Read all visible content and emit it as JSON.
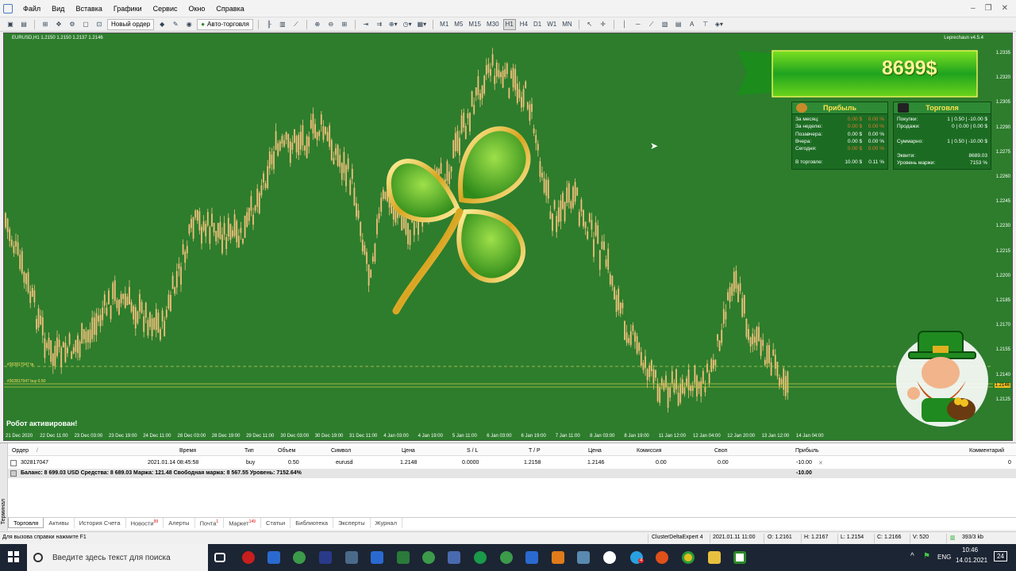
{
  "menu": {
    "items": [
      "Файл",
      "Вид",
      "Вставка",
      "Графики",
      "Сервис",
      "Окно",
      "Справка"
    ],
    "controls": [
      "–",
      "❐",
      "✕"
    ]
  },
  "toolbar": {
    "new_order": "Новый ордер",
    "auto_trading": "Авто-торговля",
    "timeframes": [
      "M1",
      "M5",
      "M15",
      "M30",
      "H1",
      "H4",
      "D1",
      "W1",
      "MN"
    ],
    "text_tool": "A"
  },
  "chart": {
    "title": "EURUSD,H1  1.2150 1.2150 1.2137 1.2146",
    "indicator_version": "Leprechaun v4.5.4",
    "robot_message": "Робот активирован!",
    "tp_label": "#302817047 tp",
    "buy_label": "#302817047 buy 0.50",
    "current_price": "1.2146",
    "price_ticks": [
      "1.2335",
      "1.2320",
      "1.2305",
      "1.2290",
      "1.2275",
      "1.2260",
      "1.2245",
      "1.2230",
      "1.2215",
      "1.2200",
      "1.2185",
      "1.2170",
      "1.2155",
      "1.2140",
      "1.2125"
    ],
    "time_ticks": [
      "21 Dec 2020",
      "22 Dec 11:00",
      "23 Dec 03:00",
      "23 Dec 19:00",
      "24 Dec 11:00",
      "28 Dec 03:00",
      "28 Dec 19:00",
      "29 Dec 11:00",
      "30 Dec 03:00",
      "30 Dec 19:00",
      "31 Dec 11:00",
      "4 Jan 03:00",
      "4 Jan 19:00",
      "5 Jan 11:00",
      "6 Jan 03:00",
      "6 Jan 19:00",
      "7 Jan 11:00",
      "8 Jan 03:00",
      "8 Jan 19:00",
      "11 Jan 12:00",
      "12 Jan 04:00",
      "12 Jan 20:00",
      "13 Jan 12:00",
      "14 Jan 04:00"
    ],
    "colors": {
      "background": "#2d7d2d",
      "candle": "#f2c07a",
      "grid_line": "#c8c84a"
    }
  },
  "banner": {
    "value": "8699$"
  },
  "profit_panel": {
    "title": "Прибыль",
    "rows": [
      {
        "label": "За месяц:",
        "v1": "0.00 $",
        "v2": "0.00 %"
      },
      {
        "label": "За неделю:",
        "v1": "0.00 $",
        "v2": "0.00 %"
      },
      {
        "label": "Позавчера:",
        "v1": "0.00 $",
        "v2": "0.00 %"
      },
      {
        "label": "Вчера:",
        "v1": "0.00 $",
        "v2": "0.00 %"
      },
      {
        "label": "Сегодня:",
        "v1": "0.00 $",
        "v2": "0.00 %"
      },
      {
        "label": "В торговле:",
        "v1": "10.00 $",
        "v2": "0.11 %"
      }
    ]
  },
  "trade_panel": {
    "title": "Торговля",
    "rows": [
      {
        "label": "Покупки:",
        "value": "1 | 0.50 | -10.00 $"
      },
      {
        "label": "Продажи:",
        "value": "0 | 0.00 | 0.00 $"
      },
      {
        "label": "Суммарно:",
        "value": "1 | 0.50 | -10.00 $"
      },
      {
        "label": "Эквити:",
        "value": "8689.03"
      },
      {
        "label": "Уровень маржи:",
        "value": "7153 %"
      }
    ]
  },
  "terminal": {
    "side_label": "Терминал",
    "columns": [
      "Ордер",
      "/",
      "Время",
      "Тип",
      "Объем",
      "Символ",
      "Цена",
      "S / L",
      "T / P",
      "Цена",
      "Комиссия",
      "Своп",
      "Прибыль",
      "Комментарий"
    ],
    "order": {
      "id": "302817047",
      "time": "2021.01.14 08:45:58",
      "type": "buy",
      "volume": "0.50",
      "symbol": "eurusd",
      "price": "1.2148",
      "sl": "0.0000",
      "tp": "1.2158",
      "cur_price": "1.2146",
      "commission": "0.00",
      "swap": "0.00",
      "profit": "-10.00",
      "close": "✕",
      "comment_end": "0"
    },
    "balance_text": "Баланс: 8 699.03 USD  Средства: 8 689.03  Маржа: 121.48  Свободная маржа: 8 567.55  Уровень: 7152.64%",
    "balance_profit": "-10.00",
    "tabs": [
      {
        "label": "Торговля",
        "badge": ""
      },
      {
        "label": "Активы",
        "badge": ""
      },
      {
        "label": "История Счета",
        "badge": ""
      },
      {
        "label": "Новости",
        "badge": "99"
      },
      {
        "label": "Алерты",
        "badge": ""
      },
      {
        "label": "Почта",
        "badge": "1"
      },
      {
        "label": "Маркет",
        "badge": "149"
      },
      {
        "label": "Статьи",
        "badge": ""
      },
      {
        "label": "Библиотека",
        "badge": ""
      },
      {
        "label": "Эксперты",
        "badge": ""
      },
      {
        "label": "Журнал",
        "badge": ""
      }
    ]
  },
  "status": {
    "help": "Для вызова справки нажмите F1",
    "profile": "ClusterDeltaExpert 4",
    "datetime": "2021.01.11 11:00",
    "open": "O: 1.2161",
    "high": "H: 1.2167",
    "low": "L: 1.2154",
    "close": "C: 1.2166",
    "volume": "V: 520",
    "traffic": "393/3 kb"
  },
  "taskbar": {
    "search_placeholder": "Введите здесь текст для поиска",
    "lang": "ENG",
    "time": "10:46",
    "date": "14.01.2021",
    "notif_count": "24",
    "badge": "4"
  }
}
